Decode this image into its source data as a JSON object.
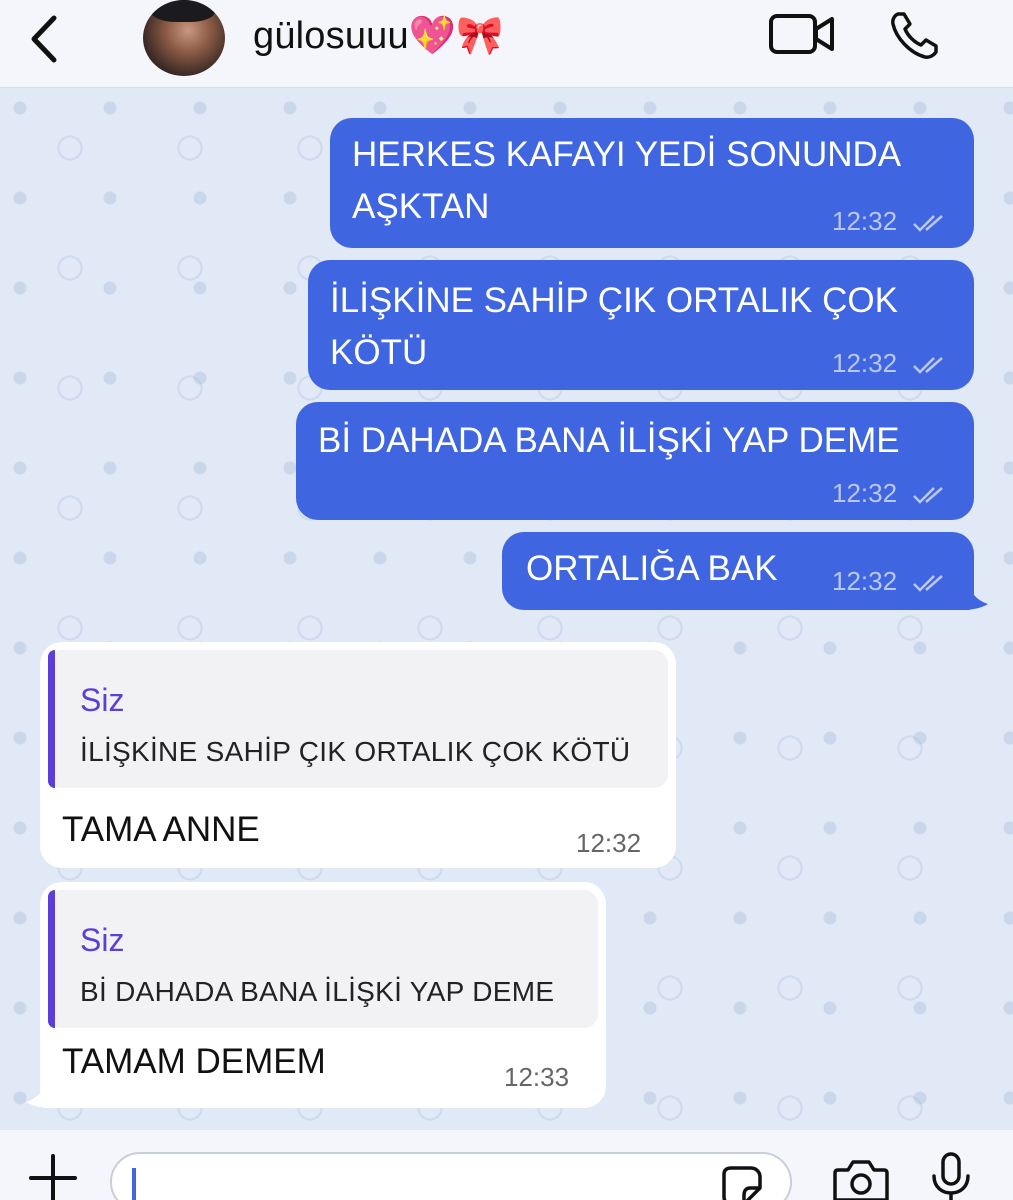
{
  "header": {
    "contact_name": "gülosuuu💖🎀",
    "icons": {
      "back": "chevron-left-icon",
      "video": "video-camera-icon",
      "call": "phone-icon"
    }
  },
  "messages": [
    {
      "direction": "outgoing",
      "lines": [
        "HERKES KAFAYI YEDİ SONUNDA",
        "AŞKTAN"
      ],
      "time": "12:32",
      "status": "read"
    },
    {
      "direction": "outgoing",
      "lines": [
        "İLİŞKİNE SAHİP ÇIK ORTALIK ÇOK",
        "KÖTÜ"
      ],
      "time": "12:32",
      "status": "read"
    },
    {
      "direction": "outgoing",
      "lines": [
        "Bİ DAHADA BANA İLİŞKİ YAP DEME"
      ],
      "time": "12:32",
      "status": "read"
    },
    {
      "direction": "outgoing",
      "lines": [
        "ORTALIĞA BAK"
      ],
      "time": "12:32",
      "status": "read"
    },
    {
      "direction": "incoming",
      "quote_author": "Siz",
      "quote_text": "İLİŞKİNE SAHİP ÇIK ORTALIK ÇOK KÖTÜ",
      "text": "TAMA ANNE",
      "time": "12:32"
    },
    {
      "direction": "incoming",
      "quote_author": "Siz",
      "quote_text": "Bİ DAHADA BANA İLİŞKİ YAP DEME",
      "text": "TAMAM DEMEM",
      "time": "12:33"
    }
  ],
  "input_bar": {
    "value": "",
    "icons": {
      "attach": "plus-icon",
      "sticker": "sticker-icon",
      "camera": "camera-icon",
      "mic": "microphone-icon"
    }
  },
  "colors": {
    "outgoing_bubble": "#3f66e0",
    "incoming_bubble": "#ffffff",
    "quote_accent": "#5b3fd6",
    "chat_background": "#e1e9f6"
  }
}
